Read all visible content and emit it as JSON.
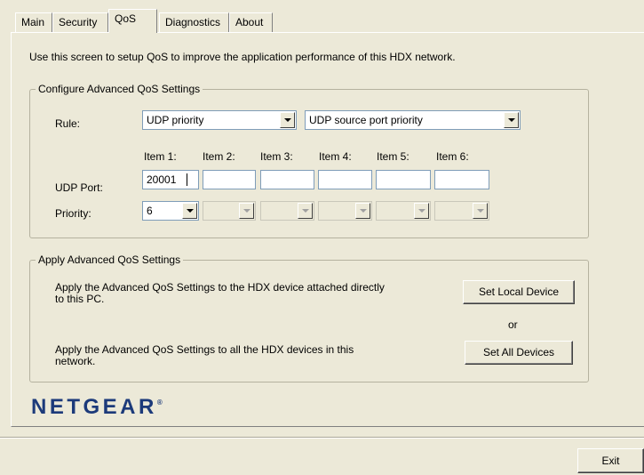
{
  "tabs": [
    {
      "label": "Main",
      "active": false
    },
    {
      "label": "Security",
      "active": false
    },
    {
      "label": "QoS",
      "active": true
    },
    {
      "label": "Diagnostics",
      "active": false
    },
    {
      "label": "About",
      "active": false
    }
  ],
  "intro_text": "Use this screen to setup QoS to improve the application performance of this HDX network.",
  "configure": {
    "legend": "Configure Advanced QoS Settings",
    "rule_label": "Rule:",
    "rule_primary": "UDP priority",
    "rule_secondary": "UDP source port priority",
    "item_headers": [
      "Item 1:",
      "Item 2:",
      "Item 3:",
      "Item 4:",
      "Item 5:",
      "Item 6:"
    ],
    "udp_port_label": "UDP Port:",
    "udp_ports": [
      "20001",
      "",
      "",
      "",
      "",
      ""
    ],
    "priority_label": "Priority:",
    "priorities": [
      "6",
      "",
      "",
      "",
      "",
      ""
    ]
  },
  "apply": {
    "legend": "Apply Advanced QoS Settings",
    "local_text": "Apply the Advanced QoS Settings to the HDX device attached directly to this PC.",
    "local_button": "Set Local Device",
    "or_text": "or",
    "all_text": "Apply the Advanced QoS Settings to all the HDX devices in this network.",
    "all_button": "Set All Devices"
  },
  "brand": "NETGEAR",
  "brand_mark": "®",
  "exit_button": "Exit",
  "colors": {
    "window_bg": "#ece9d8",
    "group_border": "#b5b29f",
    "input_border": "#7f9db9",
    "brand": "#1c3a7a"
  }
}
